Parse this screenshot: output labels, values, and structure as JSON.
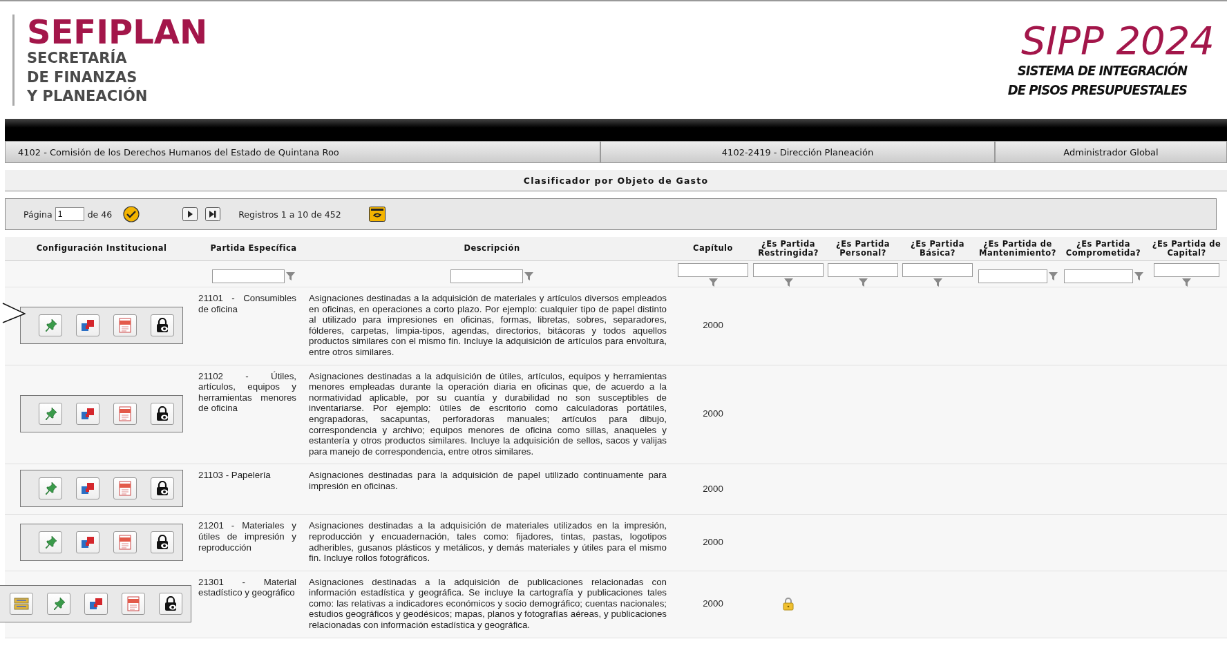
{
  "header": {
    "logo_title": "SEFIPLAN",
    "logo_lines": [
      "SECRETARÍA",
      "DE FINANZAS",
      "Y PLANEACIÓN"
    ],
    "system_title": "SIPP 2024",
    "system_lines": [
      "SISTEMA DE INTEGRACIÓN",
      "DE PISOS PRESUPUESTALES"
    ]
  },
  "info_bar": [
    "4102 - Comisión de los Derechos Humanos del Estado de Quintana Roo",
    "4102-2419 - Dirección Planeación",
    "Administrador Global"
  ],
  "section_title": "Clasificador por Objeto de Gasto",
  "pager": {
    "page_label": "Página",
    "page": "1",
    "of": "de 46",
    "records": "Registros 1 a 10 de 452"
  },
  "table": {
    "columns": [
      {
        "label": "Configuración Institucional",
        "kind": "actions",
        "filter": false
      },
      {
        "label": "Partida Específica",
        "kind": "text",
        "filter": true,
        "filter_below": false
      },
      {
        "label": "Descripción",
        "kind": "text",
        "filter": true,
        "filter_below": false
      },
      {
        "label": "Capítulo",
        "kind": "center",
        "filter": true,
        "filter_below": true
      },
      {
        "label": "¿Es Partida Restringida?",
        "kind": "flag",
        "filter": true,
        "filter_below": true
      },
      {
        "label": "¿Es Partida Personal?",
        "kind": "flag",
        "filter": true,
        "filter_below": true
      },
      {
        "label": "¿Es Partida Básica?",
        "kind": "flag",
        "filter": true,
        "filter_below": true
      },
      {
        "label": "¿Es Partida de Mantenimiento?",
        "kind": "flag",
        "filter": true,
        "filter_below": false
      },
      {
        "label": "¿Es Partida Comprometida?",
        "kind": "flag",
        "filter": true,
        "filter_below": false
      },
      {
        "label": "¿Es Partida de Capital?",
        "kind": "flag",
        "filter": true,
        "filter_below": true
      }
    ],
    "rows": [
      {
        "actions": [
          {
            "kind": "pin"
          },
          {
            "kind": "puzzle"
          },
          {
            "kind": "pdf"
          },
          {
            "kind": "lock"
          }
        ],
        "pointer": true,
        "partida": "21101 - Consumibles de oficina",
        "descripcion": "Asignaciones destinadas a la adquisición de materiales y artículos diversos empleados en oficinas, en operaciones a corto plazo. Por ejemplo: cualquier tipo de papel distinto al utilizado para impresiones en oficinas, formas, libretas, sobres, separadores, fólderes, carpetas, limpia-tipos, agendas, directorios, bitácoras y todos aquellos productos similares con el mismo fin. Incluye la adquisición de artículos para envoltura, entre otros similares.",
        "capitulo": "2000",
        "restringida": false
      },
      {
        "actions": [
          {
            "kind": "pin"
          },
          {
            "kind": "puzzle"
          },
          {
            "kind": "pdf"
          },
          {
            "kind": "lock"
          }
        ],
        "pointer": false,
        "partida": "21102 - Útiles, artículos, equipos y herramientas menores de oficina",
        "descripcion": "Asignaciones destinadas a la adquisición de útiles, artículos, equipos y herramientas menores empleadas durante la operación diaria en oficinas que, de acuerdo a la normatividad aplicable, por su cuantía y durabilidad no son susceptibles de inventariarse. Por ejemplo: útiles de escritorio como calculadoras portátiles, engrapadoras, sacapuntas, perforadoras manuales; artículos para dibujo, correspondencia y archivo; equipos menores de oficina como sillas, anaqueles y estantería y otros productos similares. Incluye la adquisición de sellos, sacos y valijas para manejo de correspondencia, entre otros similares.",
        "capitulo": "2000",
        "restringida": false
      },
      {
        "actions": [
          {
            "kind": "pin"
          },
          {
            "kind": "puzzle"
          },
          {
            "kind": "pdf"
          },
          {
            "kind": "lock"
          }
        ],
        "pointer": false,
        "partida": "21103 - Papelería",
        "descripcion": "Asignaciones destinadas para la adquisición de papel utilizado continuamente para impresión en oficinas.",
        "capitulo": "2000",
        "restringida": false
      },
      {
        "actions": [
          {
            "kind": "pin"
          },
          {
            "kind": "puzzle"
          },
          {
            "kind": "pdf"
          },
          {
            "kind": "lock"
          }
        ],
        "pointer": false,
        "partida": "21201 - Materiales y útiles de impresión y reproducción",
        "descripcion": "Asignaciones destinadas a la adquisición de materiales utilizados en la impresión, reproducción y encuadernación, tales como: fijadores, tintas, pastas, logotipos adheribles, gusanos plásticos y metálicos, y demás materiales y útiles para el mismo fin. Incluye rollos fotográficos.",
        "capitulo": "2000",
        "restringida": false
      },
      {
        "actions": [
          {
            "kind": "stack"
          },
          {
            "kind": "pin"
          },
          {
            "kind": "puzzle"
          },
          {
            "kind": "pdf"
          },
          {
            "kind": "lock"
          }
        ],
        "pointer": false,
        "partida": "21301 - Material estadístico y geográfico",
        "descripcion": "Asignaciones destinadas a la adquisición de publicaciones relacionadas con información estadística y geográfica. Se incluye la cartografía y publicaciones tales como: las relativas a indicadores económicos y socio demográfico; cuentas nacionales; estudios geográficos y geodésicos; mapas, planos y fotografías aéreas, y publicaciones relacionadas con información estadística y geográfica.",
        "capitulo": "2000",
        "restringida": true
      }
    ]
  }
}
